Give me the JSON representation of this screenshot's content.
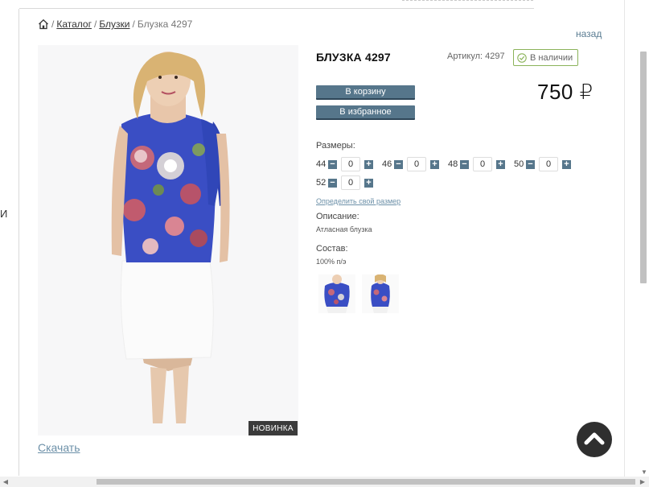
{
  "breadcrumb": {
    "sep": "/",
    "catalog": "Каталог",
    "blouses": "Блузки",
    "current": "Блузка 4297"
  },
  "nav": {
    "back": "назад"
  },
  "product": {
    "title": "БЛУЗКА 4297",
    "sku": "Артикул: 4297",
    "stock": "В наличии",
    "price": "750 ₽",
    "new_badge": "НОВИНКА",
    "download": "Скачать"
  },
  "actions": {
    "cart": "В корзину",
    "favorites": "В избранное"
  },
  "sizes": {
    "label": "Размеры:",
    "items": [
      {
        "size": "44",
        "qty": "0"
      },
      {
        "size": "46",
        "qty": "0"
      },
      {
        "size": "48",
        "qty": "0"
      },
      {
        "size": "50",
        "qty": "0"
      },
      {
        "size": "52",
        "qty": "0"
      }
    ],
    "minus": "−",
    "plus": "+",
    "guide": "Определить свой размер"
  },
  "description": {
    "label": "Описание:",
    "value": "Атласная блузка"
  },
  "composition": {
    "label": "Состав:",
    "value": "100% п/э"
  },
  "left_edge_letter": "И",
  "colors": {
    "accent": "#56768b",
    "stock_border": "#8bb35a",
    "link": "#6c90a8",
    "badge_bg": "#3b3b3b"
  },
  "icons": [
    "home-icon",
    "check-circle-icon",
    "chevron-up-icon"
  ]
}
